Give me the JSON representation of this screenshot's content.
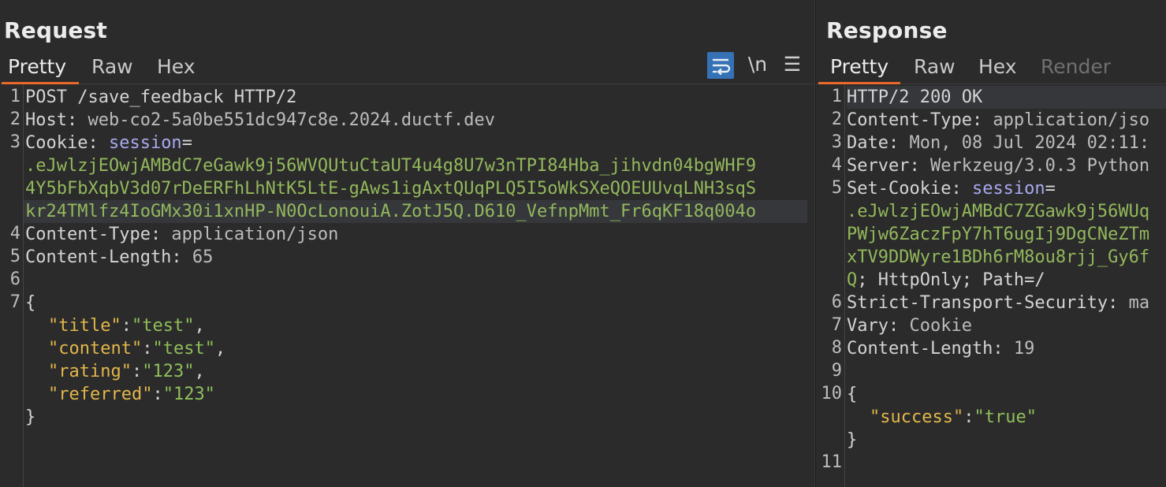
{
  "request": {
    "title": "Request",
    "tabs": [
      "Pretty",
      "Raw",
      "Hex"
    ],
    "tools": {
      "newline": "\\n",
      "menu": "☰"
    },
    "line_numbers": [
      "1",
      "2",
      "3",
      "4",
      "5",
      "6",
      "7"
    ],
    "l1": "POST /save_feedback HTTP/2",
    "l2_key": "Host:",
    "l2_val": " web-co2-5a0be551dc947c8e.2024.ductf.dev",
    "l3_key": "Cookie:",
    "l3_param": " session",
    "l3_eq": "=",
    "cookie_lines": [
      ".eJwlzjEOwjAMBdC7eGawk9j56WVQUtuCtaUT4u4g8U7w3nTPI84Hba_jihvdn04bgWHF9",
      "4Y5bFbXqbV3d07rDeERFhLhNtK5LtE-gAws1igAxtQUqPLQ5I5oWkSXeQOEUUvqLNH3sqS",
      "kr24TMlfz4IoGMx30i1xnHP-N0OcLonouiA.ZotJ5Q.D610_VefnpMmt_Fr6qKF18q004o"
    ],
    "l4_key": "Content-Type:",
    "l4_val": " application/json",
    "l5_key": "Content-Length:",
    "l5_val": " 65",
    "json_open": "{",
    "json_close": "}",
    "json_rows": [
      {
        "key": "\"title\"",
        "value": "\"test\"",
        "sep": ","
      },
      {
        "key": "\"content\"",
        "value": "\"test\"",
        "sep": ","
      },
      {
        "key": "\"rating\"",
        "value": "\"123\"",
        "sep": ","
      },
      {
        "key": "\"referred\"",
        "value": "\"123\"",
        "sep": ""
      }
    ]
  },
  "response": {
    "title": "Response",
    "tabs": [
      "Pretty",
      "Raw",
      "Hex",
      "Render"
    ],
    "line_numbers": [
      "1",
      "2",
      "3",
      "4",
      "5",
      "6",
      "7",
      "8",
      "9",
      "10",
      "11"
    ],
    "l1": "HTTP/2 200 OK",
    "l2_key": "Content-Type:",
    "l2_val": " application/jso",
    "l3_key": "Date:",
    "l3_val": " Mon, 08 Jul 2024 02:11:",
    "l4_key": "Server:",
    "l4_val": " Werkzeug/3.0.3 Python",
    "l5_key": "Set-Cookie:",
    "l5_param": " session",
    "l5_eq": "=",
    "cookie_lines": [
      ".eJwlzjEOwjAMBdC7ZGawk9j56WUq",
      "PWjw6ZaczFpY7hT6ugIj9DgCNeZTm",
      "xTV9DDWyre1BDh6rM8ou8rjj_Gy6f"
    ],
    "cookie_tail_q": "Q",
    "cookie_tail_rest": "; HttpOnly; Path=/",
    "l6_key": "Strict-Transport-Security:",
    "l6_val": " ma",
    "l7_key": "Vary:",
    "l7_val": " Cookie",
    "l8_key": "Content-Length:",
    "l8_val": " 19",
    "json_open": "{",
    "json_close": "}",
    "json_key": "\"success\"",
    "json_colon": ":",
    "json_value": "\"true\""
  }
}
